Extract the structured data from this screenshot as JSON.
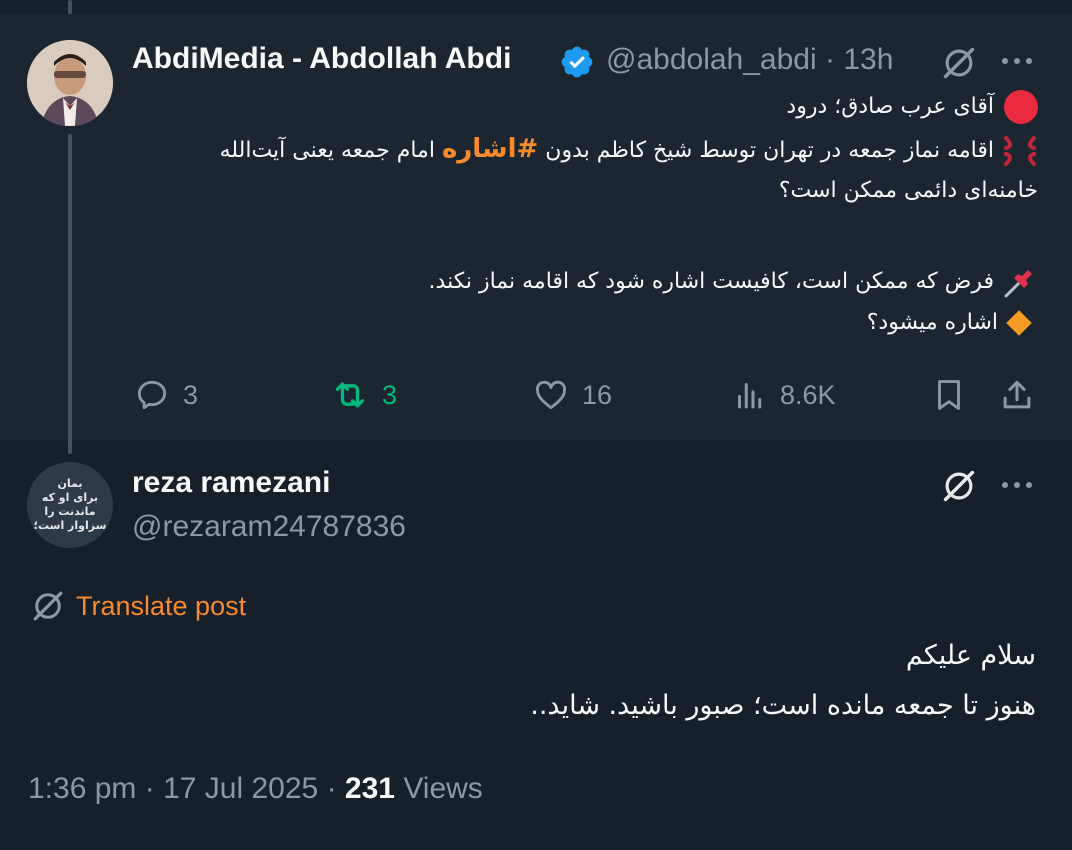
{
  "post": {
    "author_name": "AbdiMedia - Abdollah Abdi",
    "author_handle": "@abdolah_abdi",
    "separator": "·",
    "time": "13h",
    "lines": {
      "l1": "آقای عرب صادق؛ درود",
      "l2_pre": "اقامه نماز جمعه در تهران توسط شیخ کاظم بدون ",
      "l2_hashtag": "#اشاره",
      "l2_post": " امام جمعه یعنی آیت‌الله",
      "l3": "خامنه‌ای دائمی ممکن است؟",
      "l4": "فرض که ممکن است، کافیست اشاره شود که اقامه نماز نکند.",
      "l5": "اشاره میشود؟"
    },
    "stats": {
      "replies": "3",
      "reposts": "3",
      "likes": "16",
      "views": "8.6K"
    }
  },
  "reply": {
    "author_name": "reza ramezani",
    "author_handle": "@rezaram24787836",
    "avatar_text": "بمان\nبرای او که\nماندنت را\nسزاوار است؛",
    "translate_label": "Translate post",
    "line1": "سلام علیکم",
    "line2": "هنوز تا جمعه مانده است؛ صبور باشید. شاید..",
    "time": "1:36 pm",
    "separator1": "·",
    "date": "17 Jul 2025",
    "separator2": "·",
    "views_count": "231",
    "views_label": "Views"
  },
  "colors": {
    "background": "#15202b",
    "post_background": "#1b2631",
    "accent": "#1d9bf0",
    "hashtag": "#f98a2b",
    "muted": "#8b98a5",
    "repost_green": "#00ba7c"
  }
}
